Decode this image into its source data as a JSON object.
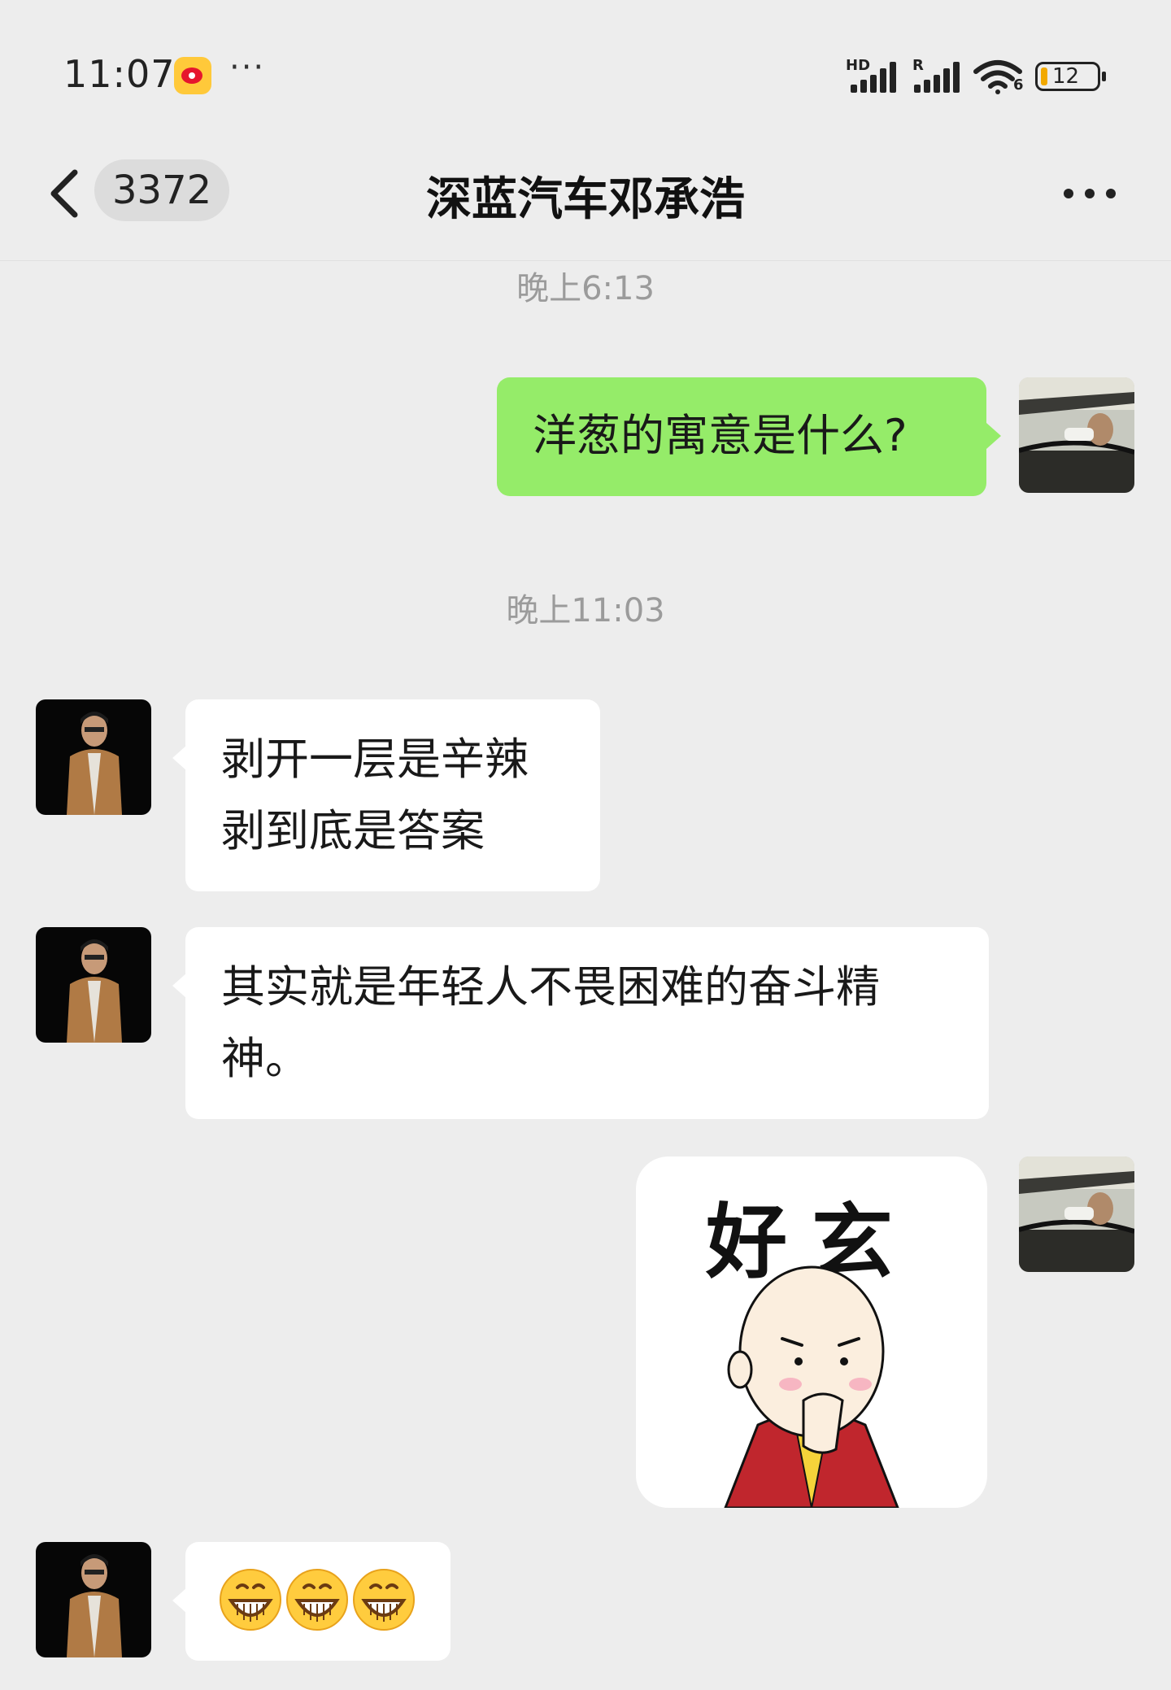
{
  "status_bar": {
    "time": "11:07",
    "more": "···",
    "network_label": "HD",
    "roaming_label": "R",
    "wifi_label": "6",
    "battery": "12"
  },
  "nav": {
    "unread_count": "3372",
    "title": "深蓝汽车邓承浩",
    "more_icon": "more-dots-icon"
  },
  "messages": {
    "ts1": "晚上6:13",
    "ts2": "晚上11:03",
    "m1_text": "洋葱的寓意是什么?",
    "m2_line1": "剥开一层是辛辣",
    "m2_line2": "剥到底是答案",
    "m3_line1": "其实就是年轻人不畏困难的奋斗精",
    "m3_line2": "神。",
    "m4_sticker_text": "好玄",
    "m5_emojis": "grinning-face-emoji x3"
  },
  "colors": {
    "background": "#ededed",
    "outgoing_bubble": "#95ec69",
    "incoming_bubble": "#ffffff",
    "timestamp": "#9b9b9b"
  }
}
